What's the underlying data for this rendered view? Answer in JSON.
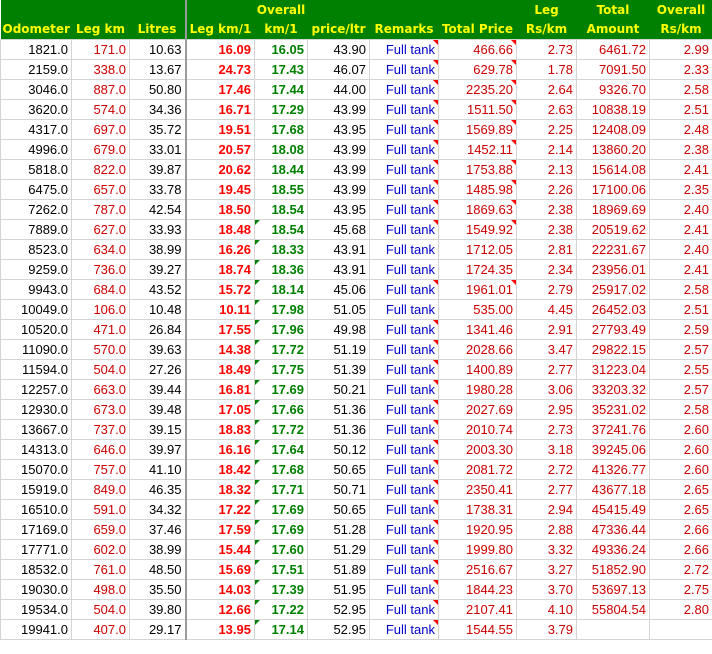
{
  "headers": {
    "odometer": [
      "",
      "Odometer"
    ],
    "leg_km": [
      "",
      "Leg km"
    ],
    "litres": [
      "",
      "Litres"
    ],
    "leg_kml": [
      "",
      "Leg km/1"
    ],
    "overall_kml": [
      "Overall",
      "km/1"
    ],
    "price": [
      "",
      "price/ltr"
    ],
    "remarks": [
      "",
      "Remarks"
    ],
    "total_price": [
      "",
      "Total Price"
    ],
    "leg_rs": [
      "Leg",
      "Rs/km"
    ],
    "overall_total": [
      "Total",
      "Amount"
    ],
    "overall_rs": [
      "Overall",
      "Rs/km"
    ]
  },
  "rows": [
    [
      "1821.0",
      "171.0",
      "10.63",
      "16.09",
      "16.05",
      "43.90",
      "Full tank",
      "466.66",
      "2.73",
      "6461.72",
      "2.99"
    ],
    [
      "2159.0",
      "338.0",
      "13.67",
      "24.73",
      "17.43",
      "46.07",
      "Full tank",
      "629.78",
      "1.78",
      "7091.50",
      "2.33"
    ],
    [
      "3046.0",
      "887.0",
      "50.80",
      "17.46",
      "17.44",
      "44.00",
      "Full tank",
      "2235.20",
      "2.64",
      "9326.70",
      "2.58"
    ],
    [
      "3620.0",
      "574.0",
      "34.36",
      "16.71",
      "17.29",
      "43.99",
      "Full tank",
      "1511.50",
      "2.63",
      "10838.19",
      "2.51"
    ],
    [
      "4317.0",
      "697.0",
      "35.72",
      "19.51",
      "17.68",
      "43.95",
      "Full tank",
      "1569.89",
      "2.25",
      "12408.09",
      "2.48"
    ],
    [
      "4996.0",
      "679.0",
      "33.01",
      "20.57",
      "18.08",
      "43.99",
      "Full tank",
      "1452.11",
      "2.14",
      "13860.20",
      "2.38"
    ],
    [
      "5818.0",
      "822.0",
      "39.87",
      "20.62",
      "18.44",
      "43.99",
      "Full tank",
      "1753.88",
      "2.13",
      "15614.08",
      "2.41"
    ],
    [
      "6475.0",
      "657.0",
      "33.78",
      "19.45",
      "18.55",
      "43.99",
      "Full tank",
      "1485.98",
      "2.26",
      "17100.06",
      "2.35"
    ],
    [
      "7262.0",
      "787.0",
      "42.54",
      "18.50",
      "18.54",
      "43.95",
      "Full tank",
      "1869.63",
      "2.38",
      "18969.69",
      "2.40"
    ],
    [
      "7889.0",
      "627.0",
      "33.93",
      "18.48",
      "18.54",
      "45.68",
      "Full tank",
      "1549.92",
      "2.38",
      "20519.62",
      "2.41"
    ],
    [
      "8523.0",
      "634.0",
      "38.99",
      "16.26",
      "18.33",
      "43.91",
      "Full tank",
      "1712.05",
      "2.81",
      "22231.67",
      "2.40"
    ],
    [
      "9259.0",
      "736.0",
      "39.27",
      "18.74",
      "18.36",
      "43.91",
      "Full tank",
      "1724.35",
      "2.34",
      "23956.01",
      "2.41"
    ],
    [
      "9943.0",
      "684.0",
      "43.52",
      "15.72",
      "18.14",
      "45.06",
      "Full tank",
      "1961.01",
      "2.79",
      "25917.02",
      "2.58"
    ],
    [
      "10049.0",
      "106.0",
      "10.48",
      "10.11",
      "17.98",
      "51.05",
      "Full tank",
      "535.00",
      "4.45",
      "26452.03",
      "2.51"
    ],
    [
      "10520.0",
      "471.0",
      "26.84",
      "17.55",
      "17.96",
      "49.98",
      "Full tank",
      "1341.46",
      "2.91",
      "27793.49",
      "2.59"
    ],
    [
      "11090.0",
      "570.0",
      "39.63",
      "14.38",
      "17.72",
      "51.19",
      "Full tank",
      "2028.66",
      "3.47",
      "29822.15",
      "2.57"
    ],
    [
      "11594.0",
      "504.0",
      "27.26",
      "18.49",
      "17.75",
      "51.39",
      "Full tank",
      "1400.89",
      "2.77",
      "31223.04",
      "2.55"
    ],
    [
      "12257.0",
      "663.0",
      "39.44",
      "16.81",
      "17.69",
      "50.21",
      "Full tank",
      "1980.28",
      "3.06",
      "33203.32",
      "2.57"
    ],
    [
      "12930.0",
      "673.0",
      "39.48",
      "17.05",
      "17.66",
      "51.36",
      "Full tank",
      "2027.69",
      "2.95",
      "35231.02",
      "2.58"
    ],
    [
      "13667.0",
      "737.0",
      "39.15",
      "18.83",
      "17.72",
      "51.36",
      "Full tank",
      "2010.74",
      "2.73",
      "37241.76",
      "2.60"
    ],
    [
      "14313.0",
      "646.0",
      "39.97",
      "16.16",
      "17.64",
      "50.12",
      "Full tank",
      "2003.30",
      "3.18",
      "39245.06",
      "2.60"
    ],
    [
      "15070.0",
      "757.0",
      "41.10",
      "18.42",
      "17.68",
      "50.65",
      "Full tank",
      "2081.72",
      "2.72",
      "41326.77",
      "2.60"
    ],
    [
      "15919.0",
      "849.0",
      "46.35",
      "18.32",
      "17.71",
      "50.71",
      "Full tank",
      "2350.41",
      "2.77",
      "43677.18",
      "2.65"
    ],
    [
      "16510.0",
      "591.0",
      "34.32",
      "17.22",
      "17.69",
      "50.65",
      "Full tank",
      "1738.31",
      "2.94",
      "45415.49",
      "2.65"
    ],
    [
      "17169.0",
      "659.0",
      "37.46",
      "17.59",
      "17.69",
      "51.28",
      "Full tank",
      "1920.95",
      "2.88",
      "47336.44",
      "2.66"
    ],
    [
      "17771.0",
      "602.0",
      "38.99",
      "15.44",
      "17.60",
      "51.29",
      "Full tank",
      "1999.80",
      "3.32",
      "49336.24",
      "2.66"
    ],
    [
      "18532.0",
      "761.0",
      "48.50",
      "15.69",
      "17.51",
      "51.89",
      "Full tank",
      "2516.67",
      "3.27",
      "51852.90",
      "2.72"
    ],
    [
      "19030.0",
      "498.0",
      "35.50",
      "14.03",
      "17.39",
      "51.95",
      "Full tank",
      "1844.23",
      "3.70",
      "53697.13",
      "2.75"
    ],
    [
      "19534.0",
      "504.0",
      "39.80",
      "12.66",
      "17.22",
      "52.95",
      "Full tank",
      "2107.41",
      "4.10",
      "55804.54",
      "2.80"
    ],
    [
      "19941.0",
      "407.0",
      "29.17",
      "13.95",
      "17.14",
      "52.95",
      "Full tank",
      "1544.55",
      "3.79",
      "",
      ""
    ]
  ],
  "colors": {
    "header_bg": "#008000",
    "header_text": "#ffff00",
    "red_value": "#cc0000",
    "green_value": "#008000",
    "blue_text": "#0000cc",
    "comment_marker": "#ff0000"
  }
}
